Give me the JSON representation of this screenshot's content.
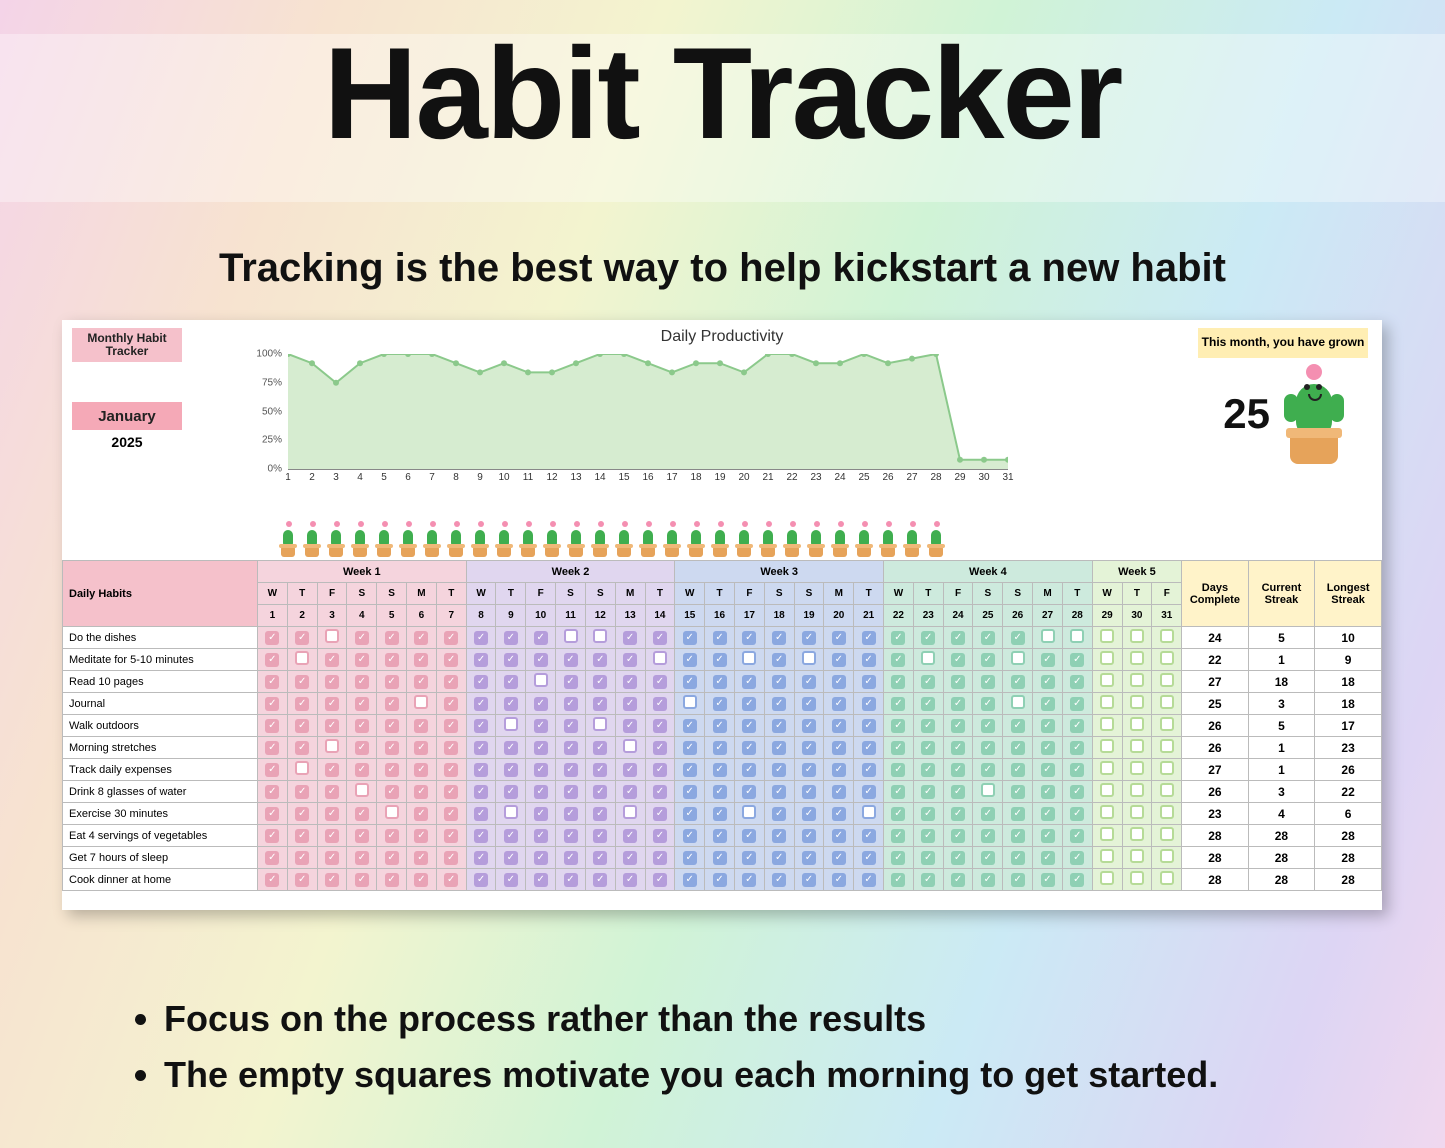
{
  "title": "Habit Tracker",
  "subtitle": "Tracking is the best way to help kickstart a new habit",
  "bullets": [
    "Focus on the process rather than the results",
    "The empty squares motivate you each morning to get started."
  ],
  "panel": {
    "mht": "Monthly Habit Tracker",
    "month": "January",
    "year": "2025",
    "grow_label": "This month, you have grown",
    "grow_count": "25"
  },
  "chart_data": {
    "type": "line",
    "title": "Daily Productivity",
    "xlabel": "",
    "ylabel": "",
    "ylim": [
      0,
      100
    ],
    "yticks": [
      "0%",
      "25%",
      "50%",
      "75%",
      "100%"
    ],
    "x": [
      1,
      2,
      3,
      4,
      5,
      6,
      7,
      8,
      9,
      10,
      11,
      12,
      13,
      14,
      15,
      16,
      17,
      18,
      19,
      20,
      21,
      22,
      23,
      24,
      25,
      26,
      27,
      28,
      29,
      30,
      31
    ],
    "values": [
      100,
      92,
      75,
      92,
      100,
      100,
      100,
      92,
      84,
      92,
      84,
      84,
      92,
      100,
      100,
      92,
      84,
      92,
      92,
      84,
      100,
      100,
      92,
      92,
      100,
      92,
      96,
      100,
      8,
      8,
      8
    ]
  },
  "cactus_days": 28,
  "weeks": [
    {
      "label": "Week 1",
      "cls": "wk1",
      "days": [
        [
          "W",
          1
        ],
        [
          "T",
          2
        ],
        [
          "F",
          3
        ],
        [
          "S",
          4
        ],
        [
          "S",
          5
        ],
        [
          "M",
          6
        ],
        [
          "T",
          7
        ]
      ]
    },
    {
      "label": "Week 2",
      "cls": "wk2",
      "days": [
        [
          "W",
          8
        ],
        [
          "T",
          9
        ],
        [
          "F",
          10
        ],
        [
          "S",
          11
        ],
        [
          "S",
          12
        ],
        [
          "M",
          13
        ],
        [
          "T",
          14
        ]
      ]
    },
    {
      "label": "Week 3",
      "cls": "wk3",
      "days": [
        [
          "W",
          15
        ],
        [
          "T",
          16
        ],
        [
          "F",
          17
        ],
        [
          "S",
          18
        ],
        [
          "S",
          19
        ],
        [
          "M",
          20
        ],
        [
          "T",
          21
        ]
      ]
    },
    {
      "label": "Week 4",
      "cls": "wk4",
      "days": [
        [
          "W",
          22
        ],
        [
          "T",
          23
        ],
        [
          "F",
          24
        ],
        [
          "S",
          25
        ],
        [
          "S",
          26
        ],
        [
          "M",
          27
        ],
        [
          "T",
          28
        ]
      ]
    },
    {
      "label": "Week 5",
      "cls": "wk5",
      "days": [
        [
          "W",
          29
        ],
        [
          "T",
          30
        ],
        [
          "F",
          31
        ]
      ]
    }
  ],
  "stats_headers": [
    "Days Complete",
    "Current Streak",
    "Longest Streak"
  ],
  "habits_header": "Daily Habits",
  "habits": [
    {
      "name": "Do the dishes",
      "checks": [
        1,
        1,
        0,
        1,
        1,
        1,
        1,
        1,
        1,
        1,
        0,
        0,
        1,
        1,
        1,
        1,
        1,
        1,
        1,
        1,
        1,
        1,
        1,
        1,
        1,
        1,
        0,
        0,
        0,
        0,
        0
      ],
      "stats": [
        24,
        5,
        10
      ]
    },
    {
      "name": "Meditate for 5-10 minutes",
      "checks": [
        1,
        0,
        1,
        1,
        1,
        1,
        1,
        1,
        1,
        1,
        1,
        1,
        1,
        0,
        1,
        1,
        0,
        1,
        0,
        1,
        1,
        1,
        0,
        1,
        1,
        0,
        1,
        1,
        0,
        0,
        0
      ],
      "stats": [
        22,
        1,
        9
      ]
    },
    {
      "name": "Read 10 pages",
      "checks": [
        1,
        1,
        1,
        1,
        1,
        1,
        1,
        1,
        1,
        0,
        1,
        1,
        1,
        1,
        1,
        1,
        1,
        1,
        1,
        1,
        1,
        1,
        1,
        1,
        1,
        1,
        1,
        1,
        0,
        0,
        0
      ],
      "stats": [
        27,
        18,
        18
      ]
    },
    {
      "name": "Journal",
      "checks": [
        1,
        1,
        1,
        1,
        1,
        0,
        1,
        1,
        1,
        1,
        1,
        1,
        1,
        1,
        0,
        1,
        1,
        1,
        1,
        1,
        1,
        1,
        1,
        1,
        1,
        0,
        1,
        1,
        0,
        0,
        0
      ],
      "stats": [
        25,
        3,
        18
      ]
    },
    {
      "name": "Walk outdoors",
      "checks": [
        1,
        1,
        1,
        1,
        1,
        1,
        1,
        1,
        0,
        1,
        1,
        0,
        1,
        1,
        1,
        1,
        1,
        1,
        1,
        1,
        1,
        1,
        1,
        1,
        1,
        1,
        1,
        1,
        0,
        0,
        0
      ],
      "stats": [
        26,
        5,
        17
      ]
    },
    {
      "name": "Morning stretches",
      "checks": [
        1,
        1,
        0,
        1,
        1,
        1,
        1,
        1,
        1,
        1,
        1,
        1,
        0,
        1,
        1,
        1,
        1,
        1,
        1,
        1,
        1,
        1,
        1,
        1,
        1,
        1,
        1,
        1,
        0,
        0,
        0
      ],
      "stats": [
        26,
        1,
        23
      ]
    },
    {
      "name": "Track daily expenses",
      "checks": [
        1,
        0,
        1,
        1,
        1,
        1,
        1,
        1,
        1,
        1,
        1,
        1,
        1,
        1,
        1,
        1,
        1,
        1,
        1,
        1,
        1,
        1,
        1,
        1,
        1,
        1,
        1,
        1,
        0,
        0,
        0
      ],
      "stats": [
        27,
        1,
        26
      ]
    },
    {
      "name": "Drink 8 glasses of water",
      "checks": [
        1,
        1,
        1,
        0,
        1,
        1,
        1,
        1,
        1,
        1,
        1,
        1,
        1,
        1,
        1,
        1,
        1,
        1,
        1,
        1,
        1,
        1,
        1,
        1,
        0,
        1,
        1,
        1,
        0,
        0,
        0
      ],
      "stats": [
        26,
        3,
        22
      ]
    },
    {
      "name": "Exercise 30 minutes",
      "checks": [
        1,
        1,
        1,
        1,
        0,
        1,
        1,
        1,
        0,
        1,
        1,
        1,
        0,
        1,
        1,
        1,
        0,
        1,
        1,
        1,
        0,
        1,
        1,
        1,
        1,
        1,
        1,
        1,
        0,
        0,
        0
      ],
      "stats": [
        23,
        4,
        6
      ]
    },
    {
      "name": "Eat 4 servings of vegetables",
      "checks": [
        1,
        1,
        1,
        1,
        1,
        1,
        1,
        1,
        1,
        1,
        1,
        1,
        1,
        1,
        1,
        1,
        1,
        1,
        1,
        1,
        1,
        1,
        1,
        1,
        1,
        1,
        1,
        1,
        0,
        0,
        0
      ],
      "stats": [
        28,
        28,
        28
      ]
    },
    {
      "name": "Get 7 hours of sleep",
      "checks": [
        1,
        1,
        1,
        1,
        1,
        1,
        1,
        1,
        1,
        1,
        1,
        1,
        1,
        1,
        1,
        1,
        1,
        1,
        1,
        1,
        1,
        1,
        1,
        1,
        1,
        1,
        1,
        1,
        0,
        0,
        0
      ],
      "stats": [
        28,
        28,
        28
      ]
    },
    {
      "name": "Cook dinner at home",
      "checks": [
        1,
        1,
        1,
        1,
        1,
        1,
        1,
        1,
        1,
        1,
        1,
        1,
        1,
        1,
        1,
        1,
        1,
        1,
        1,
        1,
        1,
        1,
        1,
        1,
        1,
        1,
        1,
        1,
        0,
        0,
        0
      ],
      "stats": [
        28,
        28,
        28
      ]
    }
  ]
}
